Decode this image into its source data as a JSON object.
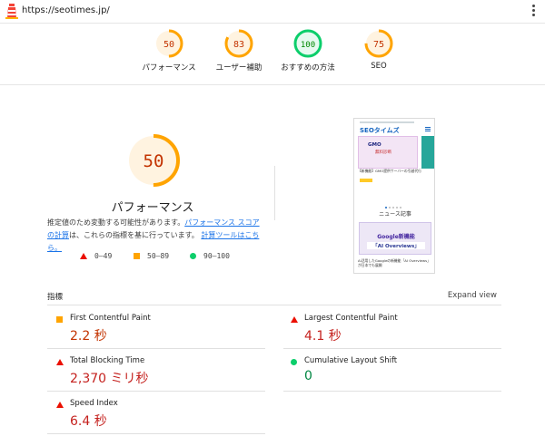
{
  "url": "https://seotimes.jp/",
  "icons": {
    "logo": "lighthouse-icon",
    "menu": "more-vert-icon"
  },
  "summary": [
    {
      "score": 50,
      "label": "パフォーマンス",
      "color": "#ffa400",
      "bg": "#fff3e0",
      "text": "#c33300"
    },
    {
      "score": 83,
      "label": "ユーザー補助",
      "color": "#ffa400",
      "bg": "#fff3e0",
      "text": "#c33300"
    },
    {
      "score": 100,
      "label": "おすすめの方法",
      "color": "#0cce6b",
      "bg": "#e6faf0",
      "text": "#008800"
    },
    {
      "score": 75,
      "label": "SEO",
      "color": "#ffa400",
      "bg": "#fff3e0",
      "text": "#c33300"
    }
  ],
  "performance": {
    "score": 50,
    "title": "パフォーマンス",
    "desc_1": "推定値のため変動する可能性があります。",
    "desc_link_1": "パフォーマンス スコアの計算",
    "desc_2": "は、これらの指標を基に行っています。",
    "desc_link_2": "計算ツールはこちら。"
  },
  "legend": [
    {
      "shape": "triangle",
      "range": "0–49"
    },
    {
      "shape": "square",
      "range": "50–89"
    },
    {
      "shape": "circle",
      "range": "90–100"
    }
  ],
  "thumbnail": {
    "brand": "SEOタイムズ",
    "banner_main": "GMO",
    "banner_sub": "無料診断",
    "caption_1": "【新機能】GMO提供サーバーの引越代行",
    "section": "ニュース記事",
    "image_main": "Google新機能",
    "image_sub": "「AI Overviews」",
    "caption_2": "AI活用したGoogleの新機能「AI Overviews」が日本でも展開"
  },
  "metrics": {
    "heading": "指標",
    "expand_label": "Expand view",
    "items": [
      {
        "name": "First Contentful Paint",
        "value": "2.2 秒",
        "status": "average"
      },
      {
        "name": "Largest Contentful Paint",
        "value": "4.1 秒",
        "status": "fail"
      },
      {
        "name": "Total Blocking Time",
        "value": "2,370 ミリ秒",
        "status": "fail"
      },
      {
        "name": "Cumulative Layout Shift",
        "value": "0",
        "status": "pass"
      },
      {
        "name": "Speed Index",
        "value": "6.4 秒",
        "status": "fail"
      }
    ]
  }
}
